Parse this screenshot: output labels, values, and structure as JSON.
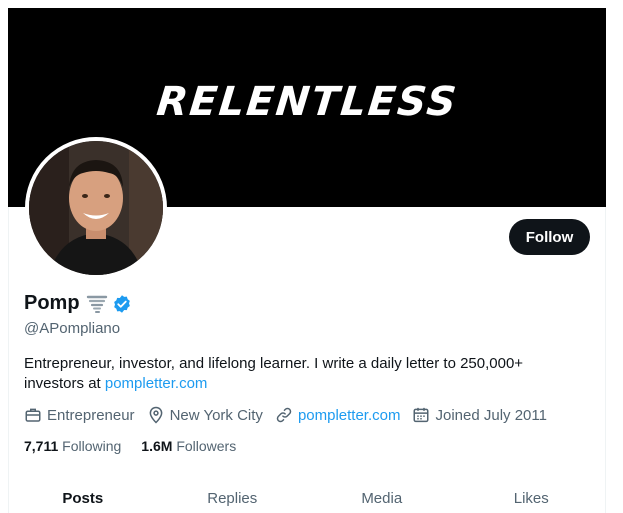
{
  "banner": {
    "text": "RELENTLESS"
  },
  "header": {
    "follow_label": "Follow"
  },
  "profile": {
    "name": "Pomp",
    "handle": "@APompliano",
    "bio_text": "Entrepreneur, investor, and lifelong learner. I write a daily letter to 250,000+ investors at ",
    "bio_link": "pompletter.com"
  },
  "meta": {
    "occupation": "Entrepreneur",
    "location": "New York City",
    "website": "pompletter.com",
    "joined": "Joined July 2011"
  },
  "stats": {
    "following_count": "7,711",
    "following_label": "Following",
    "followers_count": "1.6M",
    "followers_label": "Followers"
  },
  "tabs": [
    {
      "label": "Posts"
    },
    {
      "label": "Replies"
    },
    {
      "label": "Media"
    },
    {
      "label": "Likes"
    }
  ],
  "colors": {
    "accent": "#1d9bf0",
    "text_primary": "#0f1419",
    "text_secondary": "#536471"
  }
}
